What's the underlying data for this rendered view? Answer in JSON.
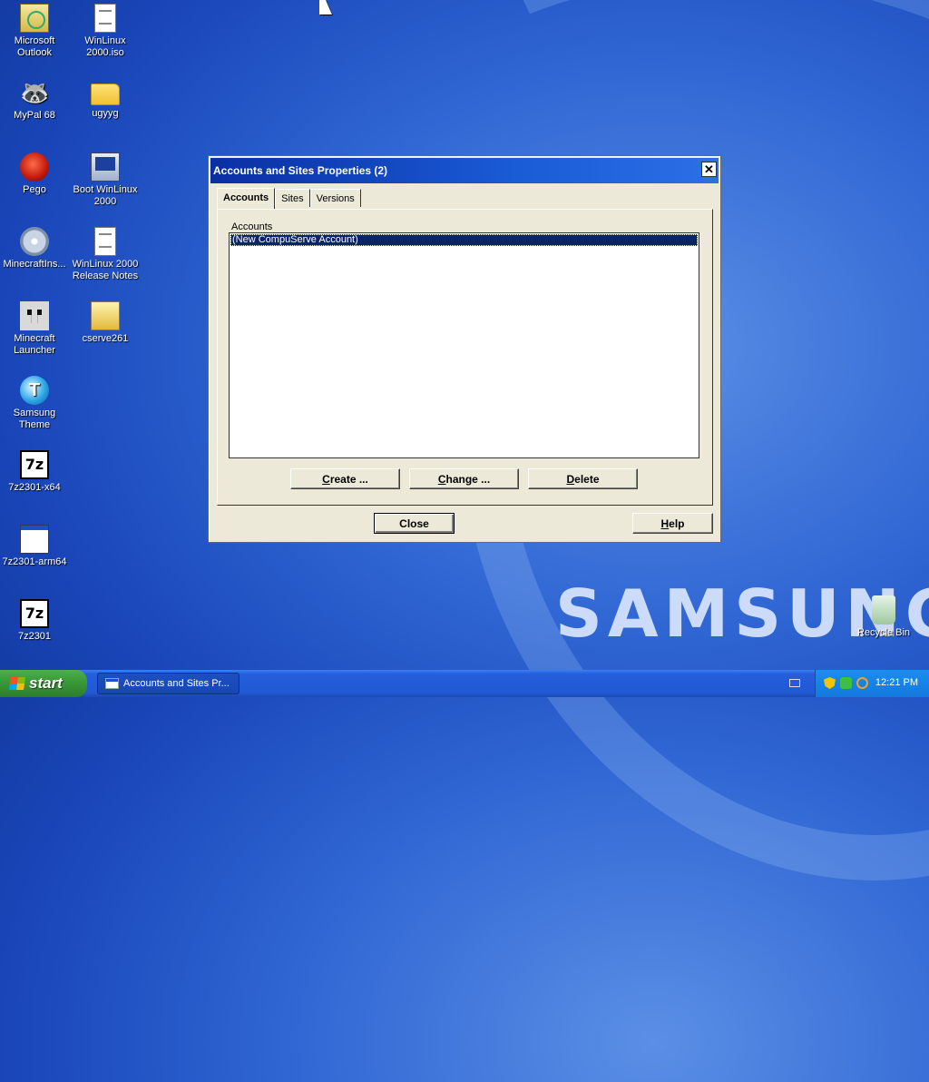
{
  "desktop": {
    "brand": "SAMSUNG",
    "icons": [
      {
        "label": "Microsoft Outlook",
        "line1": "Microsoft",
        "line2": "Outlook"
      },
      {
        "label": "WinLinux 2000.iso",
        "line1": "WinLinux",
        "line2": "2000.iso"
      },
      {
        "label": "MyPal 68",
        "line1": "MyPal 68",
        "line2": ""
      },
      {
        "label": "ugyyg",
        "line1": "ugyyg",
        "line2": ""
      },
      {
        "label": "Pego",
        "line1": "Pego",
        "line2": ""
      },
      {
        "label": "Boot WinLinux 2000",
        "line1": "Boot WinLinux",
        "line2": "2000"
      },
      {
        "label": "MinecraftIns...",
        "line1": "MinecraftIns...",
        "line2": ""
      },
      {
        "label": "WinLinux 2000 Release Notes",
        "line1": "WinLinux 2000",
        "line2": "Release Notes"
      },
      {
        "label": "Minecraft Launcher",
        "line1": "Minecraft",
        "line2": "Launcher"
      },
      {
        "label": "cserve261",
        "line1": "cserve261",
        "line2": ""
      },
      {
        "label": "Samsung Theme",
        "line1": "Samsung",
        "line2": "Theme"
      },
      {
        "label": "7z2301-x64",
        "line1": "7z2301-x64",
        "line2": ""
      },
      {
        "label": "7z2301-arm64",
        "line1": "7z2301-arm64",
        "line2": ""
      },
      {
        "label": "7z2301",
        "line1": "7z2301",
        "line2": ""
      },
      {
        "label": "Recycle Bin",
        "line1": "Recycle Bin",
        "line2": ""
      }
    ],
    "icon_glyphs": {
      "seven_zip": "7z",
      "samsung_theme": "T",
      "mypal": "🦝"
    }
  },
  "dialog": {
    "title": "Accounts and Sites Properties  (2)",
    "close_glyph": "✕",
    "tabs": [
      {
        "label": "Accounts",
        "active": true
      },
      {
        "label": "Sites",
        "active": false
      },
      {
        "label": "Versions",
        "active": false
      }
    ],
    "group_label": "Accounts",
    "list_items": [
      "(New CompuServe Account)"
    ],
    "selected_index": 0,
    "buttons": {
      "create": {
        "accel": "C",
        "rest": "reate ..."
      },
      "change": {
        "accel": "C",
        "rest": "hange ..."
      },
      "delete": {
        "accel": "D",
        "rest": "elete"
      },
      "close": {
        "accel": "",
        "rest": "Close"
      },
      "help": {
        "accel": "H",
        "rest": "elp"
      }
    }
  },
  "taskbar": {
    "start_label": "start",
    "task_label": "Accounts and Sites Pr...",
    "clock": "12:21 PM"
  },
  "colors": {
    "titlebar": "#0a2fa2",
    "selection": "#0a246a",
    "start_button": "#3c9a3a",
    "tray": "#1478dd"
  }
}
